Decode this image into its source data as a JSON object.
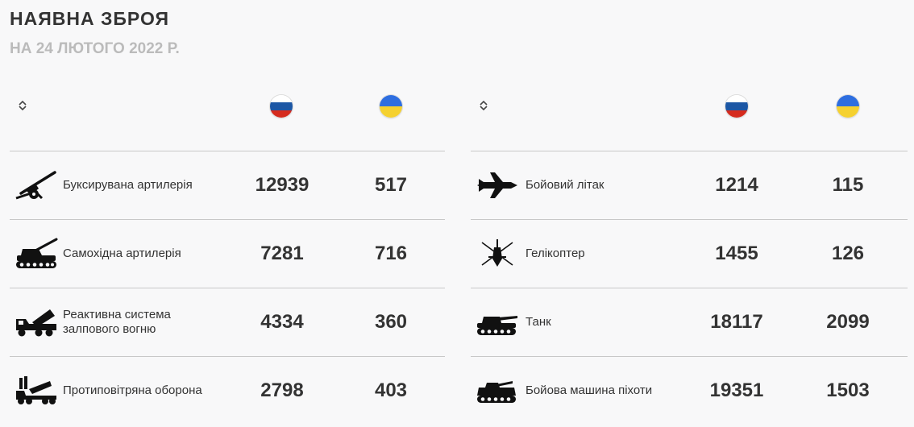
{
  "title": "НАЯВНА ЗБРОЯ",
  "subtitle": "НА 24 ЛЮТОГО 2022 Р.",
  "columns": [
    {
      "name": "russia-flag-icon",
      "colors": [
        "#ffffff",
        "#1c57a5",
        "#d52b1e"
      ]
    },
    {
      "name": "ukraine-flag-icon",
      "colors": [
        "#2e6ee0",
        "#f5d130"
      ]
    }
  ],
  "left_rows": [
    {
      "label": "Буксирувана артилерія",
      "icon": "towed-artillery-icon",
      "russia": "12939",
      "ukraine": "517"
    },
    {
      "label": "Самохідна артилерія",
      "icon": "self-propelled-artillery-icon",
      "russia": "7281",
      "ukraine": "716"
    },
    {
      "label": "Реактивна система залпового вогню",
      "icon": "rocket-launcher-icon",
      "russia": "4334",
      "ukraine": "360"
    },
    {
      "label": "Протиповітряна оборона",
      "icon": "air-defense-icon",
      "russia": "2798",
      "ukraine": "403"
    }
  ],
  "right_rows": [
    {
      "label": "Бойовий літак",
      "icon": "fighter-jet-icon",
      "russia": "1214",
      "ukraine": "115"
    },
    {
      "label": "Гелікоптер",
      "icon": "helicopter-icon",
      "russia": "1455",
      "ukraine": "126"
    },
    {
      "label": "Танк",
      "icon": "tank-icon",
      "russia": "18117",
      "ukraine": "2099"
    },
    {
      "label": "Бойова машина піхоти",
      "icon": "ifv-icon",
      "russia": "19351",
      "ukraine": "1503"
    }
  ],
  "chart_data": {
    "type": "table",
    "columns": [
      "",
      "",
      ""
    ],
    "rows": [
      [
        "Буксирувана артилерія",
        12939,
        517
      ],
      [
        "Самохідна артилерія",
        7281,
        716
      ],
      [
        "Реактивна система залпового вогню",
        4334,
        360
      ],
      [
        "Протиповітряна оборона",
        2798,
        403
      ],
      [
        "Бойовий літак",
        1214,
        115
      ],
      [
        "Гелікоптер",
        1455,
        126
      ],
      [
        "Танк",
        18117,
        2099
      ],
      [
        "Бойова машина піхоти",
        19351,
        1503
      ]
    ]
  }
}
